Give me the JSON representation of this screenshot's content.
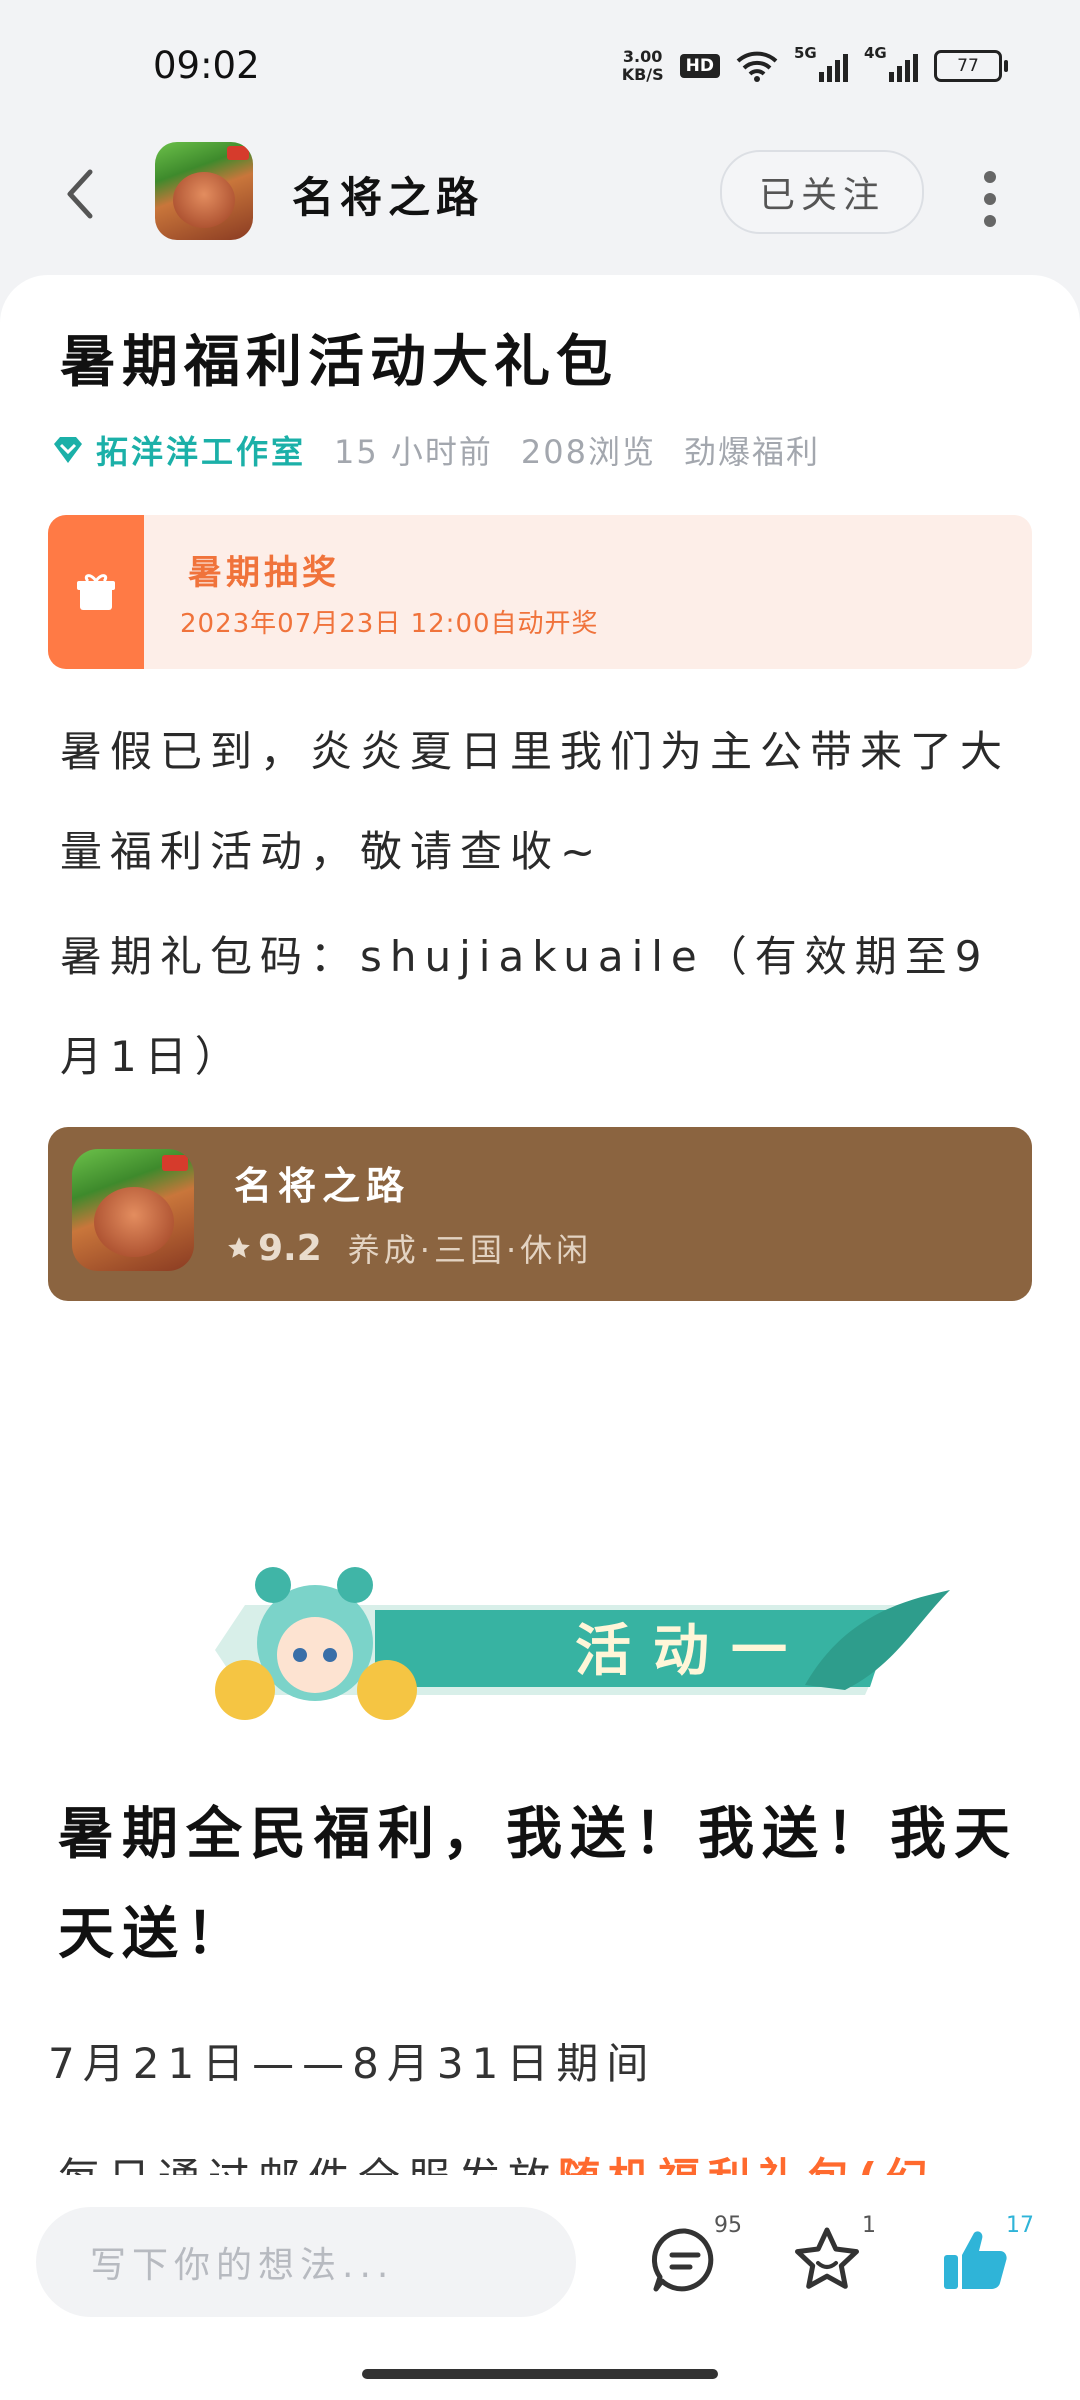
{
  "status_bar": {
    "time": "09:02",
    "speed": "3.00",
    "speed_unit": "KB/S",
    "hd": "HD",
    "net1": "5G",
    "net2": "4G",
    "battery": "77"
  },
  "nav": {
    "title": "名将之路",
    "follow_label": "已关注"
  },
  "post": {
    "title": "暑期福利活动大礼包",
    "author": "拓洋洋工作室",
    "time_ago": "15 小时前",
    "views": "208浏览",
    "category": "劲爆福利"
  },
  "lottery": {
    "title": "暑期抽奖",
    "time": "2023年07月23日 12:00自动开奖"
  },
  "body": {
    "para1": "暑假已到，炎炎夏日里我们为主公带来了大量福利活动，敬请查收~",
    "para2": "暑期礼包码：shujiakuaile（有效期至9月1日）"
  },
  "game_card": {
    "name": "名将之路",
    "rating": "9.2",
    "tags": "养成·三国·休闲"
  },
  "banner": {
    "text": "活动一"
  },
  "section": {
    "heading": "暑期全民福利，我送！我送！我天天送！",
    "date_range": "7月21日——8月31日期间",
    "cut_text": "每日通过邮件全服发放",
    "cut_highlight": "随机福利礼包(幻"
  },
  "bottom_bar": {
    "comment_placeholder": "写下你的想法...",
    "comments_count": "95",
    "favorites_count": "1",
    "likes_count": "17"
  },
  "colors": {
    "accent_teal": "#1bb0a8",
    "lottery_orange": "#ff7a45",
    "game_card_brown": "#8b6440",
    "like_blue": "#2fb4d8"
  }
}
